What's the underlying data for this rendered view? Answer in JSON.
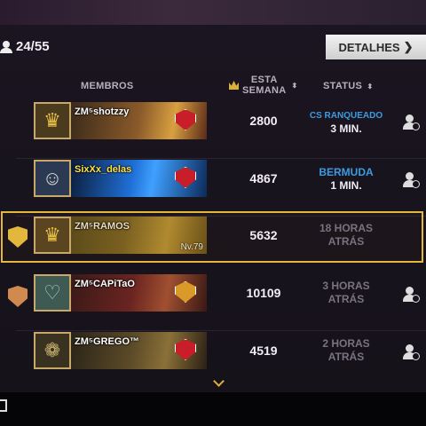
{
  "header": {
    "member_count": "24/55",
    "details_label": "DETALHES"
  },
  "columns": {
    "members": "MEMBROS",
    "week_line1": "ESTA",
    "week_line2": "SEMANA",
    "status": "STATUS"
  },
  "members": [
    {
      "name": "ZM⁵shotzzy",
      "score": "2800",
      "status_line1": "CS RANQUEADO",
      "status_line2": "3 MIN.",
      "status_color": "#3d9be0",
      "avatar": "gold-crown-avatar",
      "banner_color": "#8a5a2a"
    },
    {
      "name": "SixXx_delas",
      "score": "4867",
      "status_line1": "BERMUDA",
      "status_line2": "1 MIN.",
      "status_color": "#3d9be0",
      "avatar": "anime-character-avatar",
      "banner_color": "#1f6fd6"
    },
    {
      "name": "ZM⁵RAMOS",
      "score": "5632",
      "status_line1": "18 HORAS",
      "status_line2": "ATRÁS",
      "status_color": "#7a7280",
      "level": "Nv.79",
      "avatar": "gold-crown-avatar",
      "banner_color": "#7a6020"
    },
    {
      "name": "ZM⁵CAPiTaO",
      "score": "10109",
      "status_line1": "3 HORAS",
      "status_line2": "ATRÁS",
      "status_color": "#7a7280",
      "avatar": "heart-frame-avatar",
      "banner_color": "#6a2420"
    },
    {
      "name": "ZM⁵GREGO™",
      "score": "4519",
      "status_line1": "2 HORAS",
      "status_line2": "ATRÁS",
      "status_color": "#7a7280",
      "avatar": "ornament-avatar",
      "banner_color": "#5c4a28"
    }
  ],
  "colors": {
    "highlight": "#e2b73c",
    "online": "#3d9be0",
    "offline": "#7a7280",
    "badge": "#c81e2a"
  }
}
